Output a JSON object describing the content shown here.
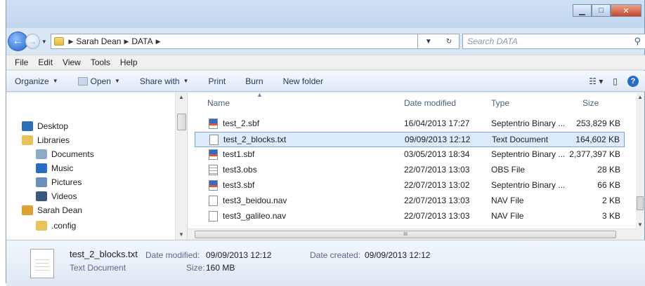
{
  "breadcrumb": [
    "Sarah Dean",
    "DATA"
  ],
  "search": {
    "placeholder": "Search DATA"
  },
  "menu": [
    "File",
    "Edit",
    "View",
    "Tools",
    "Help"
  ],
  "commands": {
    "organize": "Organize",
    "open": "Open",
    "share": "Share with",
    "print": "Print",
    "burn": "Burn",
    "new_folder": "New folder"
  },
  "nav": {
    "items": [
      {
        "label": "Desktop",
        "icon": "desktop-icon",
        "color": "#2d6fb8"
      },
      {
        "label": "Libraries",
        "icon": "libraries-icon",
        "color": "#e8c35c"
      },
      {
        "label": "Documents",
        "icon": "documents-icon",
        "color": "#8fa9c9"
      },
      {
        "label": "Music",
        "icon": "music-icon",
        "color": "#2a6bc4"
      },
      {
        "label": "Pictures",
        "icon": "pictures-icon",
        "color": "#6a8fb9"
      },
      {
        "label": "Videos",
        "icon": "videos-icon",
        "color": "#37577f"
      },
      {
        "label": "Sarah Dean",
        "icon": "user-folder-icon",
        "color": "#d9a233"
      },
      {
        "label": ".config",
        "icon": "folder-icon",
        "color": "#e8c35c"
      }
    ]
  },
  "columns": {
    "name": "Name",
    "date": "Date modified",
    "type": "Type",
    "size": "Size"
  },
  "files": [
    {
      "name": "test_2.sbf",
      "date": "16/04/2013 17:27",
      "type": "Septentrio Binary ...",
      "size": "253,829 KB",
      "icon": "sbf"
    },
    {
      "name": "test_2_blocks.txt",
      "date": "09/09/2013 12:12",
      "type": "Text Document",
      "size": "164,602 KB",
      "icon": "txt"
    },
    {
      "name": "test1.sbf",
      "date": "03/05/2013 18:34",
      "type": "Septentrio Binary ...",
      "size": "2,377,397 KB",
      "icon": "sbf"
    },
    {
      "name": "test3.obs",
      "date": "22/07/2013 13:03",
      "type": "OBS File",
      "size": "28 KB",
      "icon": "obs"
    },
    {
      "name": "test3.sbf",
      "date": "22/07/2013 13:02",
      "type": "Septentrio Binary ...",
      "size": "66 KB",
      "icon": "sbf"
    },
    {
      "name": "test3_beidou.nav",
      "date": "22/07/2013 13:03",
      "type": "NAV File",
      "size": "2 KB",
      "icon": "txt"
    },
    {
      "name": "test3_galileo.nav",
      "date": "22/07/2013 13:03",
      "type": "NAV File",
      "size": "3 KB",
      "icon": "txt"
    }
  ],
  "selected_index": 1,
  "details": {
    "name": "test_2_blocks.txt",
    "type": "Text Document",
    "date_modified_label": "Date modified:",
    "date_modified": "09/09/2013 12:12",
    "date_created_label": "Date created:",
    "date_created": "09/09/2013 12:12",
    "size_label": "Size:",
    "size": "160 MB"
  }
}
